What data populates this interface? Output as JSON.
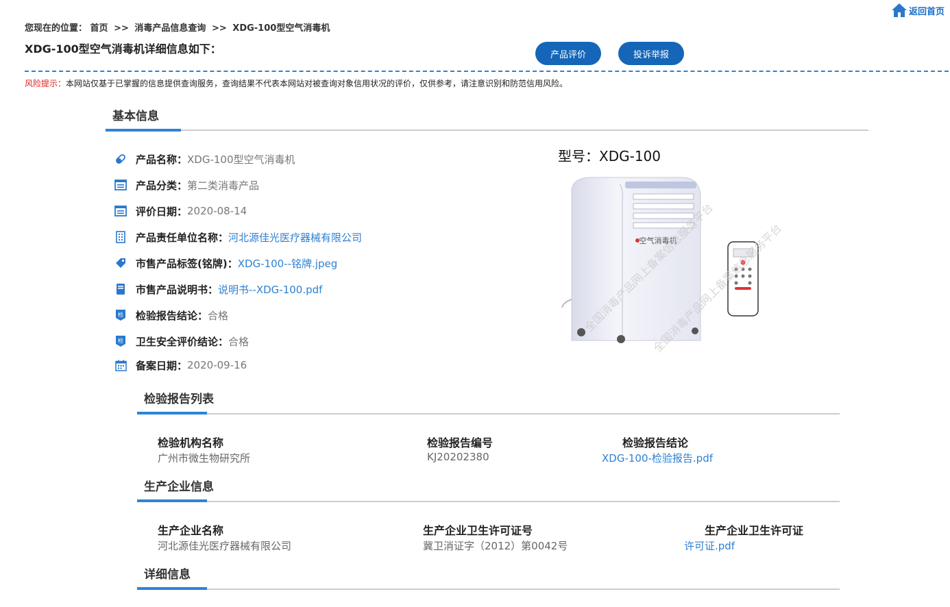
{
  "header": {
    "home_link": "返回首页",
    "breadcrumb": {
      "prefix": "您现在的位置：",
      "items": [
        "首页",
        "消毒产品信息查询",
        "XDG-100型空气消毒机"
      ],
      "separator": ">>"
    },
    "page_title": "XDG-100型空气消毒机详细信息如下：",
    "buttons": {
      "evaluate": "产品评价",
      "report": "投诉举报"
    }
  },
  "risk": {
    "label": "风险提示：",
    "text": "本网站仅基于已掌握的信息提供查询服务，查询结果不代表本网站对被查询对象信用状况的评价，仅供参考，请注意识别和防范信用风险。"
  },
  "basic_info": {
    "title": "基本信息",
    "rows": [
      {
        "icon": "tag-pill-icon",
        "key": "产品名称：",
        "value": "XDG-100型空气消毒机",
        "link": false
      },
      {
        "icon": "document-list-icon",
        "key": "产品分类：",
        "value": "第二类消毒产品",
        "link": false
      },
      {
        "icon": "document-list-icon",
        "key": "评价日期：",
        "value": "2020-08-14",
        "link": false
      },
      {
        "icon": "building-icon",
        "key": "产品责任单位名称：",
        "value": "河北源佳光医疗器械有限公司",
        "link": true
      },
      {
        "icon": "label-tag-icon",
        "key": "市售产品标签(铭牌)：",
        "value": "XDG-100--铭牌.jpeg",
        "link": true
      },
      {
        "icon": "book-icon",
        "key": "市售产品说明书：",
        "value": "说明书--XDG-100.pdf",
        "link": true
      },
      {
        "icon": "inspection-badge-icon",
        "key": "检验报告结论：",
        "value": "合格",
        "link": false
      },
      {
        "icon": "inspection-badge-icon",
        "key": "卫生安全评价结论：",
        "value": "合格",
        "link": false
      },
      {
        "icon": "calendar-icon",
        "key": "备案日期：",
        "value": "2020-09-16",
        "link": false
      }
    ],
    "image": {
      "model_caption": "型号：XDG-100",
      "device_label": "空气消毒机",
      "watermark": "全国消毒产品网上备案信息服务平台"
    }
  },
  "inspection": {
    "title": "检验报告列表",
    "headers": [
      "检验机构名称",
      "检验报告编号",
      "检验报告结论"
    ],
    "row": [
      "广州市微生物研究所",
      "KJ20202380",
      "XDG-100-检验报告.pdf"
    ]
  },
  "manufacturer": {
    "title": "生产企业信息",
    "headers": [
      "生产企业名称",
      "生产企业卫生许可证号",
      "生产企业卫生许可证"
    ],
    "row": [
      "河北源佳光医疗器械有限公司",
      "冀卫消证字（2012）第0042号",
      "许可证.pdf"
    ]
  },
  "detail": {
    "title": "详细信息"
  },
  "colors": {
    "accent": "#2c83d6",
    "button": "#1566b8",
    "link": "#2f80d1",
    "risk_label": "#dd2222"
  }
}
